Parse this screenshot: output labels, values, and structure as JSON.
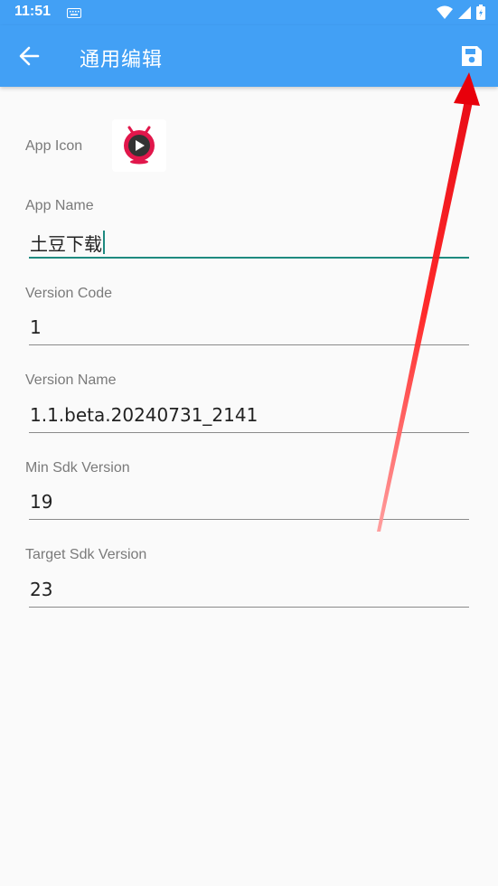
{
  "status_bar": {
    "time": "11:51",
    "icons": [
      "keyboard-icon",
      "wifi-icon",
      "signal-icon",
      "battery-icon"
    ]
  },
  "app_bar": {
    "title": "通用编辑",
    "back_icon": "arrow-left-icon",
    "save_icon": "floppy-disk-icon",
    "color": "#42a0f5"
  },
  "form": {
    "app_icon_label": "App Icon",
    "app_name_label": "App Name",
    "app_name_value": "土豆下载",
    "version_code_label": "Version Code",
    "version_code_value": "1",
    "version_name_label": "Version Name",
    "version_name_value": "1.1.beta.20240731_2141",
    "min_sdk_label": "Min Sdk Version",
    "min_sdk_value": "19",
    "target_sdk_label": "Target Sdk Version",
    "target_sdk_value": "23",
    "accent_color": "#1e8a80"
  },
  "annotation": {
    "type": "red-arrow",
    "points_to": "save-button",
    "color": "#e8000b"
  }
}
